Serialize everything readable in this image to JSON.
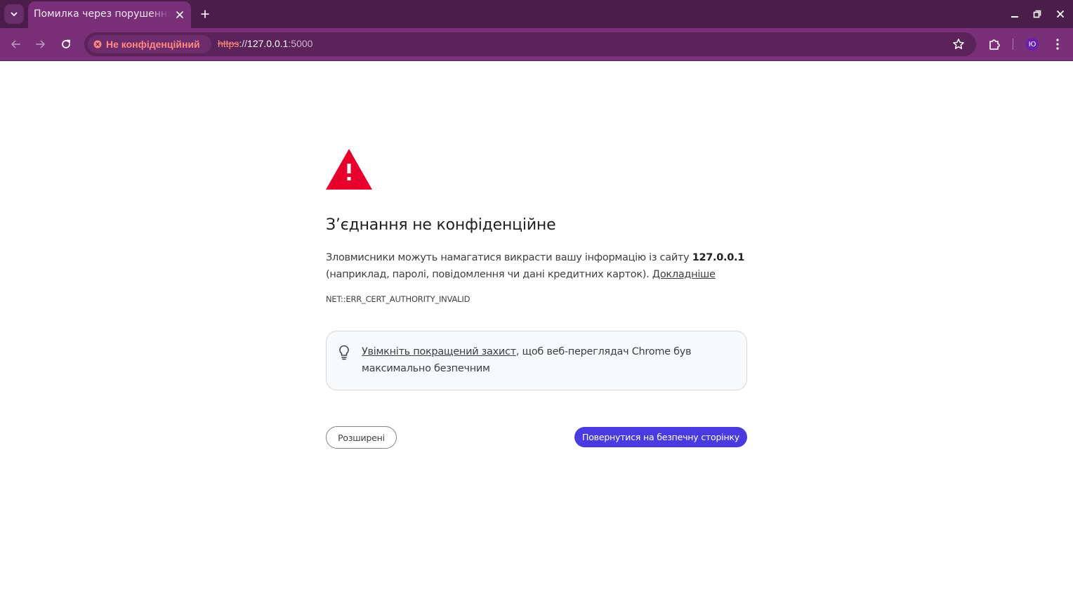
{
  "window": {
    "tab": {
      "title": "Помилка через порушення конфіденційності"
    }
  },
  "toolbar": {
    "security_chip": {
      "label": "Не конфіденційний"
    },
    "url": {
      "scheme": "https",
      "separator": "://",
      "host": "127.0.0.1",
      "port": ":5000"
    },
    "avatar_initial": "Ю"
  },
  "interstitial": {
    "heading": "З’єднання не конфіденційне",
    "description": {
      "before": "Зловмисники можуть намагатися викрасти вашу інформацію із сайту ",
      "host": "127.0.0.1",
      "after": " (наприклад, паролі, повідомлення чи дані кредитних карток). ",
      "learn_more": "Докладніше"
    },
    "error_code": "NET::ERR_CERT_AUTHORITY_INVALID",
    "promo": {
      "link": "Увімкніть покращений захист",
      "rest": ", щоб веб-переглядач Chrome був максимально безпечним"
    },
    "buttons": {
      "advanced": "Розширені",
      "back_to_safety": "Повернутися на безпечну сторінку"
    }
  },
  "colors": {
    "titlebar": "#4b1d4b",
    "toolbar": "#7a3079",
    "warning_red": "#e8002d",
    "primary_button": "#4a3be0",
    "insecure_text": "#ff8a80"
  },
  "icons": [
    "tab-list-icon",
    "close-icon",
    "plus-icon",
    "minimize-icon",
    "restore-icon",
    "window-close-icon",
    "back-arrow-icon",
    "forward-arrow-icon",
    "reload-icon",
    "not-secure-icon",
    "bookmark-star-icon",
    "extensions-icon",
    "kebab-menu-icon",
    "warning-triangle-icon",
    "lightbulb-icon"
  ]
}
